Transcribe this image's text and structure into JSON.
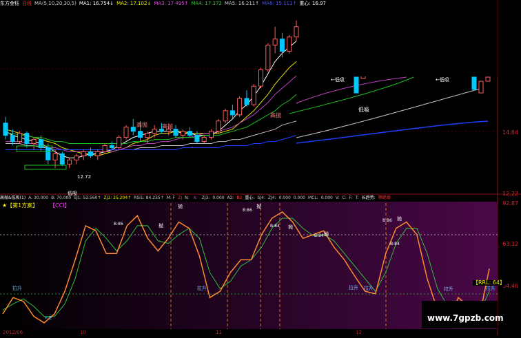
{
  "header_top": {
    "stock_name": "东方金钰",
    "period": "日线",
    "ma_params": "MA(5,10,20,30,5)",
    "ma1": "MA1: 16.754↓",
    "ma2": "MA2: 17.102↓",
    "ma3": "MA3: 17.495↑",
    "ma4": "MA4: 17.372",
    "ma5": "MA5: 16.211↑",
    "ma6": "MA6: 15.111↑",
    "center": "重心: 16.97"
  },
  "header_bottom": {
    "indicator": "高抛&低吸(1)",
    "a": "A: 30.000",
    "b": "B: 70.000",
    "sj1": "SJ1: 52.560↑",
    "zj1": "ZJ1: 25.204↑",
    "rsi1": "RSI1: 84.235↑",
    "m": "M: F",
    "zj2": "ZJ",
    "n": "N: ",
    "x": "X: ",
    "zj3": "ZJ3:",
    "v0": "0.000",
    "a2": "A2:",
    "b2": "B2",
    "center2": "重心:",
    "sj4": "SJ4:",
    "zj4": "ZJ4:",
    "v1": "0.000",
    "v2": "0.000",
    "v3": "0.000",
    "mcl": "MCL:",
    "v4": "0.000",
    "v5": "V:",
    "v6": "0.000",
    "c": "C:",
    "f": "F:",
    "t": "T:",
    "trend": "长趋势:",
    "trend_val": "隔绝锁"
  },
  "scheme_label": "★【第1方案】",
  "cci_label": "【CCI】",
  "rrl_label": "【RRL: 64】",
  "watermark": "www.7gpzb.com",
  "date_left": "2012/06",
  "date_mid1": "10",
  "date_mid2": "11",
  "date_mid3": "12",
  "chart_data": [
    {
      "type": "candlestick",
      "title": "东方金钰 日线",
      "series": [
        {
          "name": "MA1",
          "color": "#ffffff"
        },
        {
          "name": "MA2",
          "color": "#e6e600"
        },
        {
          "name": "MA3",
          "color": "#c040c0"
        },
        {
          "name": "MA4",
          "color": "#20c020"
        },
        {
          "name": "MA5",
          "color": "#c0c0c0"
        },
        {
          "name": "MA6",
          "color": "#2040ff"
        }
      ],
      "y_ticks": [
        "14.84",
        "12.22"
      ],
      "ylim": [
        11.5,
        20.5
      ],
      "annotations": [
        "高抛",
        "高抛",
        "高抛",
        "低吸",
        "低吸",
        "←低吸",
        "←低吸",
        "12.72"
      ],
      "ohlc": [
        [
          14.9,
          15.2,
          14.1,
          14.3
        ],
        [
          14.3,
          14.6,
          13.8,
          14.0
        ],
        [
          14.0,
          14.5,
          13.9,
          14.4
        ],
        [
          14.4,
          14.5,
          13.7,
          13.9
        ],
        [
          13.9,
          14.2,
          13.6,
          14.1
        ],
        [
          14.1,
          14.3,
          13.5,
          13.7
        ],
        [
          13.7,
          13.9,
          12.9,
          13.1
        ],
        [
          13.1,
          13.6,
          12.7,
          13.4
        ],
        [
          13.4,
          13.5,
          12.8,
          12.9
        ],
        [
          12.9,
          13.2,
          12.7,
          13.1
        ],
        [
          13.1,
          13.4,
          12.9,
          13.3
        ],
        [
          13.3,
          13.6,
          13.1,
          13.5
        ],
        [
          13.5,
          13.7,
          13.2,
          13.3
        ],
        [
          13.3,
          13.6,
          13.1,
          13.5
        ],
        [
          13.5,
          13.9,
          13.4,
          13.8
        ],
        [
          13.8,
          14.0,
          13.6,
          13.7
        ],
        [
          13.7,
          14.3,
          13.6,
          14.2
        ],
        [
          14.2,
          14.8,
          14.1,
          14.7
        ],
        [
          14.7,
          15.1,
          14.3,
          14.5
        ],
        [
          14.5,
          15.0,
          14.0,
          14.2
        ],
        [
          14.2,
          14.5,
          13.9,
          14.4
        ],
        [
          14.4,
          14.8,
          14.2,
          14.6
        ],
        [
          14.6,
          14.9,
          14.4,
          14.5
        ],
        [
          14.5,
          14.7,
          14.3,
          14.6
        ],
        [
          14.6,
          14.8,
          14.2,
          14.3
        ],
        [
          14.3,
          14.6,
          14.1,
          14.5
        ],
        [
          14.5,
          14.7,
          14.2,
          14.3
        ],
        [
          14.3,
          14.5,
          13.9,
          14.0
        ],
        [
          14.0,
          14.3,
          13.9,
          14.2
        ],
        [
          14.2,
          14.6,
          14.1,
          14.5
        ],
        [
          14.5,
          15.1,
          14.4,
          15.0
        ],
        [
          15.0,
          15.6,
          14.9,
          15.5
        ],
        [
          15.5,
          15.8,
          15.1,
          15.3
        ],
        [
          15.3,
          16.2,
          15.2,
          16.1
        ],
        [
          16.1,
          16.5,
          15.7,
          15.8
        ],
        [
          15.8,
          16.8,
          15.7,
          16.7
        ],
        [
          16.7,
          17.6,
          16.6,
          17.5
        ],
        [
          17.5,
          18.8,
          17.4,
          18.7
        ],
        [
          18.7,
          19.6,
          18.3,
          19.0
        ],
        [
          19.0,
          19.3,
          18.1,
          18.4
        ],
        [
          18.4,
          19.2,
          18.3,
          19.1
        ],
        [
          19.1,
          19.9,
          18.9,
          19.6
        ]
      ],
      "ma_values": {
        "MA1": [
          14.5,
          14.3,
          14.2,
          14.1,
          14.0,
          13.9,
          13.7,
          13.5,
          13.3,
          13.2,
          13.2,
          13.3,
          13.4,
          13.4,
          13.5,
          13.6,
          13.8,
          14.0,
          14.2,
          14.3,
          14.4,
          14.5,
          14.5,
          14.5,
          14.5,
          14.4,
          14.4,
          14.3,
          14.3,
          14.3,
          14.5,
          14.8,
          15.1,
          15.5,
          15.8,
          16.2,
          16.7,
          17.3,
          17.9,
          18.3,
          18.6,
          18.9
        ],
        "MA2": [
          14.6,
          14.5,
          14.4,
          14.3,
          14.2,
          14.1,
          14.0,
          13.9,
          13.7,
          13.6,
          13.5,
          13.4,
          13.4,
          13.3,
          13.4,
          13.5,
          13.6,
          13.7,
          13.9,
          14.0,
          14.1,
          14.3,
          14.4,
          14.4,
          14.5,
          14.5,
          14.4,
          14.4,
          14.4,
          14.4,
          14.4,
          14.5,
          14.6,
          14.9,
          15.2,
          15.5,
          15.9,
          16.3,
          16.8,
          17.2,
          17.6,
          17.9
        ],
        "MA3": [
          14.0,
          14.0,
          14.0,
          13.9,
          13.9,
          13.8,
          13.7,
          13.7,
          13.6,
          13.5,
          13.5,
          13.5,
          13.5,
          13.5,
          13.5,
          13.5,
          13.6,
          13.7,
          13.8,
          13.8,
          13.9,
          13.9,
          14.0,
          14.0,
          14.1,
          14.2,
          14.2,
          14.3,
          14.4,
          14.4,
          14.5,
          14.6,
          14.7,
          14.9,
          15.1,
          15.3,
          15.6,
          15.9,
          16.3,
          16.6,
          16.9,
          17.2
        ],
        "MA4": [
          14.4,
          14.4,
          14.3,
          14.3,
          14.2,
          14.2,
          14.1,
          14.0,
          14.0,
          13.9,
          13.9,
          13.9,
          13.9,
          13.9,
          13.9,
          13.9,
          13.9,
          13.9,
          14.0,
          14.0,
          14.0,
          14.1,
          14.1,
          14.1,
          14.2,
          14.2,
          14.2,
          14.2,
          14.3,
          14.3,
          14.3,
          14.4,
          14.5,
          14.6,
          14.7,
          14.9,
          15.1,
          15.3,
          15.5,
          15.8,
          16.0,
          16.3
        ],
        "MA5": [
          13.9,
          13.9,
          13.9,
          13.8,
          13.8,
          13.7,
          13.7,
          13.6,
          13.6,
          13.6,
          13.6,
          13.6,
          13.6,
          13.6,
          13.6,
          13.6,
          13.6,
          13.6,
          13.6,
          13.7,
          13.7,
          13.7,
          13.8,
          13.8,
          13.8,
          13.8,
          13.9,
          13.9,
          13.9,
          13.9,
          14.0,
          14.0,
          14.1,
          14.1,
          14.2,
          14.3,
          14.4,
          14.5,
          14.6,
          14.8,
          14.9,
          15.0
        ],
        "MA6": [
          13.6,
          13.6,
          13.6,
          13.6,
          13.6,
          13.6,
          13.6,
          13.6,
          13.6,
          13.6,
          13.6,
          13.6,
          13.6,
          13.6,
          13.6,
          13.6,
          13.6,
          13.6,
          13.6,
          13.6,
          13.6,
          13.6,
          13.6,
          13.6,
          13.6,
          13.7,
          13.7,
          13.7,
          13.7,
          13.7,
          13.7,
          13.8,
          13.8,
          13.8,
          13.8,
          13.9,
          13.9,
          14.0,
          14.0,
          14.1,
          14.2,
          14.3
        ]
      }
    },
    {
      "type": "line",
      "title": "高抛&低吸",
      "y_ticks": [
        "92.87",
        "63.12",
        "34.46"
      ],
      "ylim": [
        0,
        100
      ],
      "series": [
        {
          "name": "SJ1",
          "color": "#ff8a30"
        },
        {
          "name": "ZJ1",
          "color": "#30c040"
        }
      ],
      "values_orange": [
        12,
        25,
        22,
        10,
        5,
        12,
        30,
        55,
        82,
        78,
        60,
        60,
        82,
        90,
        72,
        62,
        72,
        85,
        80,
        58,
        25,
        30,
        45,
        55,
        55,
        75,
        88,
        93,
        85,
        72,
        75,
        78,
        65,
        55,
        42,
        30,
        28,
        60,
        80,
        85,
        75,
        40,
        15,
        5,
        25,
        18,
        8,
        48
      ],
      "values_green": [
        15,
        20,
        24,
        18,
        10,
        10,
        20,
        40,
        70,
        80,
        72,
        62,
        70,
        82,
        82,
        70,
        68,
        75,
        80,
        72,
        45,
        32,
        38,
        50,
        55,
        65,
        80,
        88,
        88,
        80,
        74,
        75,
        70,
        60,
        50,
        40,
        30,
        45,
        68,
        80,
        80,
        60,
        32,
        18,
        22,
        20,
        12,
        30
      ],
      "markers_orange": [
        "抛",
        "抛",
        "抛",
        "抛",
        "抛",
        "抛"
      ],
      "markers_text": [
        "拉升",
        "拉升",
        "拉升",
        "拉升",
        "拉升",
        "拉升"
      ],
      "b_points": [
        "B:86",
        "B:86",
        "B:84",
        "B:84",
        "B:86",
        "B:84"
      ]
    }
  ]
}
